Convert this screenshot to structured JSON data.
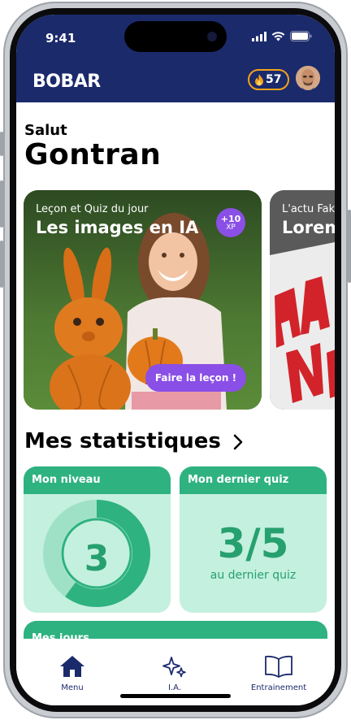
{
  "status_bar": {
    "time": "9:41"
  },
  "app": {
    "logo": "BOBAR",
    "streak": "57"
  },
  "greeting": {
    "salutation": "Salut",
    "name": "Gontran"
  },
  "cards": [
    {
      "kicker": "Leçon et Quiz du jour",
      "title": "Les images en IA",
      "xp_value": "+10",
      "xp_unit": "XP",
      "button": "Faire la leçon !"
    },
    {
      "kicker": "L'actu Fak",
      "title": "Lorem"
    }
  ],
  "stats": {
    "title": "Mes statistiques",
    "level_label": "Mon niveau",
    "level_value": "3",
    "level_progress": 0.6,
    "quiz_label": "Mon dernier quiz",
    "quiz_score": "3/5",
    "quiz_caption": "au dernier quiz",
    "days_label": "Mes jours"
  },
  "nav": [
    {
      "label": "Menu",
      "icon": "home-icon"
    },
    {
      "label": "I.A.",
      "icon": "sparkles-icon"
    },
    {
      "label": "Entrainement",
      "icon": "book-icon"
    }
  ],
  "colors": {
    "header": "#1b2a6b",
    "accent_green": "#2eb280",
    "light_green": "#c4f0df",
    "purple": "#8a4fe6",
    "streak_orange": "#f4a21b"
  }
}
